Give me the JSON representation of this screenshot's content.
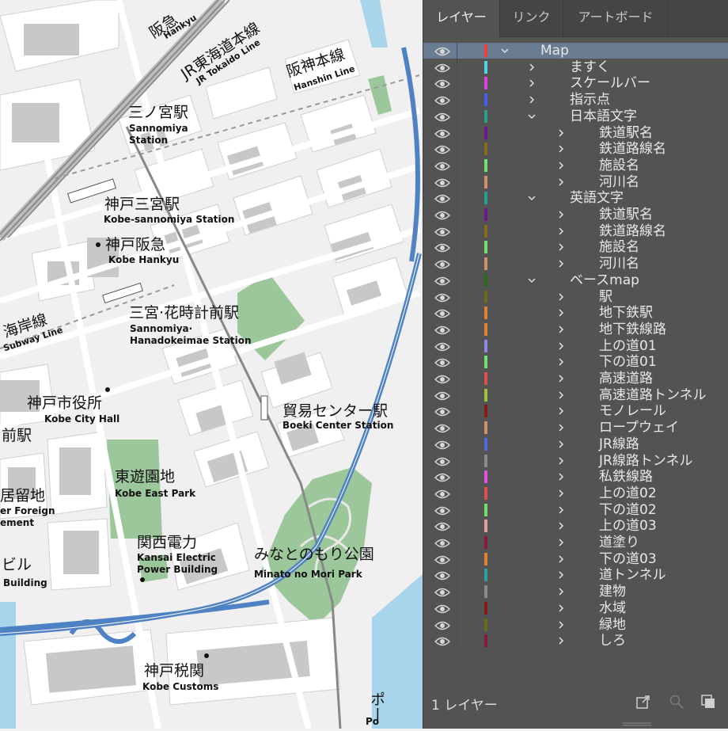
{
  "map": {
    "labels": [
      {
        "id": "hankyu-jp",
        "text": "阪急"
      },
      {
        "id": "hankyu-en",
        "text": "Hankyu"
      },
      {
        "id": "jr-jp",
        "text": "JR東海道本線"
      },
      {
        "id": "jr-en",
        "text": "JR Tokaido Line"
      },
      {
        "id": "hanshin-jp",
        "text": "阪神本線"
      },
      {
        "id": "hanshin-en",
        "text": "Hanshin Line"
      },
      {
        "id": "sannomiya-jp",
        "text": "三ノ宮駅"
      },
      {
        "id": "sannomiya-en1",
        "text": "Sannomiya"
      },
      {
        "id": "sannomiya-en2",
        "text": "Station"
      },
      {
        "id": "kobesannomiya-jp",
        "text": "神戸三宮駅"
      },
      {
        "id": "kobesannomiya-en",
        "text": "Kobe-sannomiya Station"
      },
      {
        "id": "kobehankyu-jp",
        "text": "神戸阪急"
      },
      {
        "id": "kobehankyu-en",
        "text": "Kobe Hankyu"
      },
      {
        "id": "kaigan-jp",
        "text": "海岸線"
      },
      {
        "id": "kaigan-en",
        "text": "Subway Line"
      },
      {
        "id": "hanadokei-jp",
        "text": "三宮·花時計前駅"
      },
      {
        "id": "hanadokei-en1",
        "text": "Sannomiya·"
      },
      {
        "id": "hanadokei-en2",
        "text": "Hanadokeimae Station"
      },
      {
        "id": "cityhall-jp",
        "text": "神戸市役所"
      },
      {
        "id": "cityhall-en",
        "text": "Kobe City Hall"
      },
      {
        "id": "mae-jp",
        "text": "前駅"
      },
      {
        "id": "boeki-jp",
        "text": "貿易センター駅"
      },
      {
        "id": "boeki-en",
        "text": "Boeki Center Station"
      },
      {
        "id": "eastpark-jp",
        "text": "東遊園地"
      },
      {
        "id": "eastpark-en",
        "text": "Kobe East Park"
      },
      {
        "id": "kyoryuchi-jp",
        "text": "居留地"
      },
      {
        "id": "kyoryuchi-en1",
        "text": "er Foreign"
      },
      {
        "id": "kyoryuchi-en2",
        "text": "ement"
      },
      {
        "id": "kepco-jp",
        "text": "関西電力"
      },
      {
        "id": "kepco-en1",
        "text": "Kansai Electric"
      },
      {
        "id": "kepco-en2",
        "text": "Power Building"
      },
      {
        "id": "minato-jp",
        "text": "みなとのもり公園"
      },
      {
        "id": "minato-en",
        "text": "Minato no Mori Park"
      },
      {
        "id": "biru-jp",
        "text": "ビル"
      },
      {
        "id": "biru-en",
        "text": "Building"
      },
      {
        "id": "customs-jp",
        "text": "神戸税関"
      },
      {
        "id": "customs-en",
        "text": "Kobe Customs"
      },
      {
        "id": "port-jp",
        "text": "ポー"
      },
      {
        "id": "port-en",
        "text": "Po"
      }
    ]
  },
  "panel": {
    "tabs": [
      "レイヤー",
      "リンク",
      "アートボード"
    ],
    "active_tab": 0,
    "footer_label": "1 レイヤー",
    "layers": [
      {
        "name": "Map",
        "depth": 0,
        "expanded": true,
        "color": "#e64040",
        "selected": true
      },
      {
        "name": "ますく",
        "depth": 1,
        "expanded": false,
        "color": "#4fd4e0"
      },
      {
        "name": "スケールバー",
        "depth": 1,
        "expanded": false,
        "color": "#e040e0"
      },
      {
        "name": "指示点",
        "depth": 1,
        "expanded": false,
        "color": "#4a5cf0"
      },
      {
        "name": "日本語文字",
        "depth": 1,
        "expanded": true,
        "color": "#2aa090"
      },
      {
        "name": "鉄道駅名",
        "depth": 2,
        "expanded": false,
        "color": "#6a1a8a"
      },
      {
        "name": "鉄道路線名",
        "depth": 2,
        "expanded": false,
        "color": "#8a6a1a"
      },
      {
        "name": "施設名",
        "depth": 2,
        "expanded": false,
        "color": "#70e070"
      },
      {
        "name": "河川名",
        "depth": 2,
        "expanded": false,
        "color": "#d09070"
      },
      {
        "name": "英語文字",
        "depth": 1,
        "expanded": true,
        "color": "#2aa090"
      },
      {
        "name": "鉄道駅名",
        "depth": 2,
        "expanded": false,
        "color": "#6a1a8a"
      },
      {
        "name": "鉄道路線名",
        "depth": 2,
        "expanded": false,
        "color": "#8a6a1a"
      },
      {
        "name": "施設名",
        "depth": 2,
        "expanded": false,
        "color": "#70e070"
      },
      {
        "name": "河川名",
        "depth": 2,
        "expanded": false,
        "color": "#d09070"
      },
      {
        "name": "ベースmap",
        "depth": 1,
        "expanded": true,
        "color": "#2a6a1a"
      },
      {
        "name": "駅",
        "depth": 2,
        "expanded": false,
        "color": "#6a6a1a"
      },
      {
        "name": "地下鉄駅",
        "depth": 2,
        "expanded": false,
        "color": "#e08030"
      },
      {
        "name": "地下鉄線路",
        "depth": 2,
        "expanded": false,
        "color": "#e08030"
      },
      {
        "name": "上の道01",
        "depth": 2,
        "expanded": false,
        "color": "#8a8ae0"
      },
      {
        "name": "下の道01",
        "depth": 2,
        "expanded": false,
        "color": "#70e070"
      },
      {
        "name": "高速道路",
        "depth": 2,
        "expanded": false,
        "color": "#e05050"
      },
      {
        "name": "高速道路トンネル",
        "depth": 2,
        "expanded": false,
        "color": "#a0c040"
      },
      {
        "name": "モノレール",
        "depth": 2,
        "expanded": false,
        "color": "#8a1a1a"
      },
      {
        "name": "ロープウェイ",
        "depth": 2,
        "expanded": false,
        "color": "#d09070"
      },
      {
        "name": "JR線路",
        "depth": 2,
        "expanded": false,
        "color": "#4a6ae0"
      },
      {
        "name": "JR線路トンネル",
        "depth": 2,
        "expanded": false,
        "color": "#8a8a8a"
      },
      {
        "name": "私鉄線路",
        "depth": 2,
        "expanded": false,
        "color": "#e050e0"
      },
      {
        "name": "上の道02",
        "depth": 2,
        "expanded": false,
        "color": "#e05050"
      },
      {
        "name": "下の道02",
        "depth": 2,
        "expanded": false,
        "color": "#70e070"
      },
      {
        "name": "上の道03",
        "depth": 2,
        "expanded": false,
        "color": "#e0a0a0"
      },
      {
        "name": "道塗り",
        "depth": 2,
        "expanded": false,
        "color": "#8a1a3a"
      },
      {
        "name": "下の道03",
        "depth": 2,
        "expanded": false,
        "color": "#e08030"
      },
      {
        "name": "道トンネル",
        "depth": 2,
        "expanded": false,
        "color": "#2aa0a0"
      },
      {
        "name": "建物",
        "depth": 2,
        "expanded": false,
        "color": "#8a8a8a"
      },
      {
        "name": "水域",
        "depth": 2,
        "expanded": false,
        "color": "#8a1a1a"
      },
      {
        "name": "緑地",
        "depth": 2,
        "expanded": false,
        "color": "#6a6a1a"
      },
      {
        "name": "しろ",
        "depth": 2,
        "expanded": false,
        "color": "#8a1a3a"
      }
    ]
  }
}
